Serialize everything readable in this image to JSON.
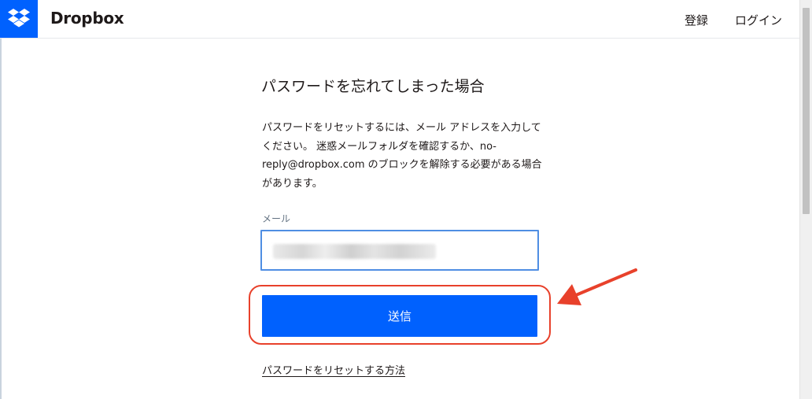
{
  "header": {
    "brand": "Dropbox",
    "nav": {
      "register": "登録",
      "login": "ログイン"
    }
  },
  "main": {
    "title": "パスワードを忘れてしまった場合",
    "description": "パスワードをリセットするには、メール アドレスを入力してください。 迷惑メールフォルダを確認するか、no-reply@dropbox.com のブロックを解除する必要がある場合があります。",
    "email": {
      "label": "メール",
      "value": ""
    },
    "submit_label": "送信",
    "help_link": "パスワードをリセットする方法"
  },
  "colors": {
    "brand_blue": "#0061fe",
    "input_focus_border": "#4f8ee3",
    "annotation_red": "#e8412b"
  }
}
